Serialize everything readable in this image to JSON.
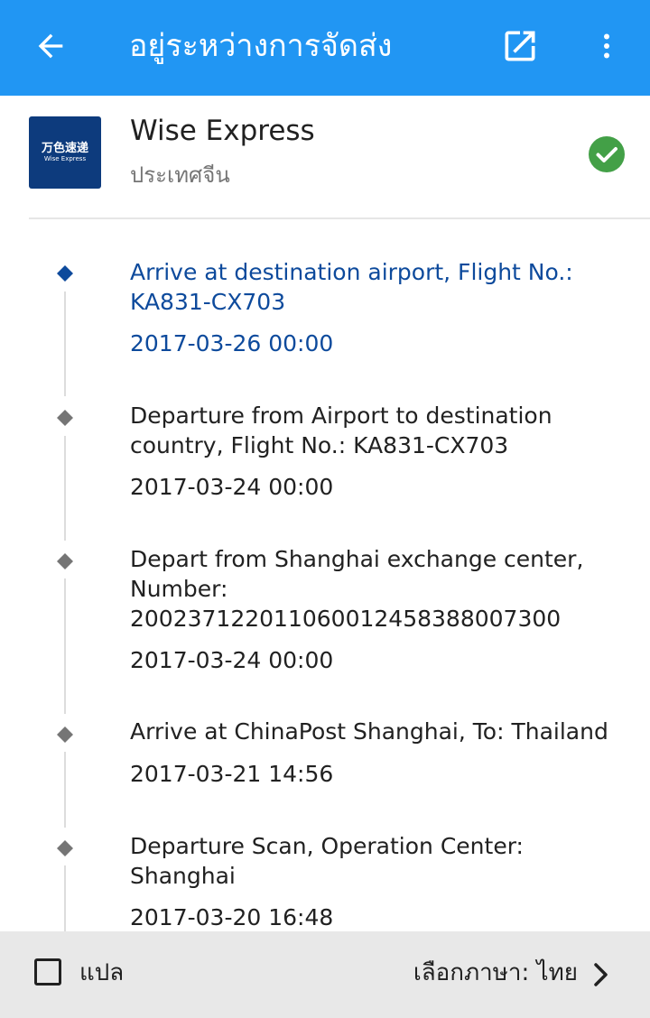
{
  "header": {
    "title": "อยู่ระหว่างการจัดส่ง",
    "back_icon": "arrow-left-icon",
    "open_icon": "open-in-new-icon",
    "more_icon": "more-vert-icon",
    "background_color": "#2196f3"
  },
  "carrier": {
    "logo_cn": "万色速递",
    "logo_en": "Wise Express",
    "name": "Wise Express",
    "country": "ประเทศจีน",
    "status_icon": "check-circle-icon",
    "status_color": "#43a047"
  },
  "events": [
    {
      "description": "Arrive at destination airport, Flight No.: KA831-CX703",
      "time": "2017-03-26 00:00",
      "current": true
    },
    {
      "description": "Departure from Airport to destination country, Flight No.: KA831-CX703",
      "time": "2017-03-24 00:00",
      "current": false
    },
    {
      "description": "Depart from Shanghai exchange center, Number: 20023712201106001245838800730​0",
      "time": "2017-03-24 00:00",
      "current": false
    },
    {
      "description": "Arrive at ChinaPost Shanghai, To: Thailand",
      "time": "2017-03-21 14:56",
      "current": false
    },
    {
      "description": "Departure Scan, Operation Center: Shanghai",
      "time": "2017-03-20 16:48",
      "current": false
    }
  ],
  "footer": {
    "translate_label": "แปล",
    "translate_checked": false,
    "language_label": "เลือกภาษา: ไทย",
    "chevron_icon": "chevron-right-icon"
  }
}
